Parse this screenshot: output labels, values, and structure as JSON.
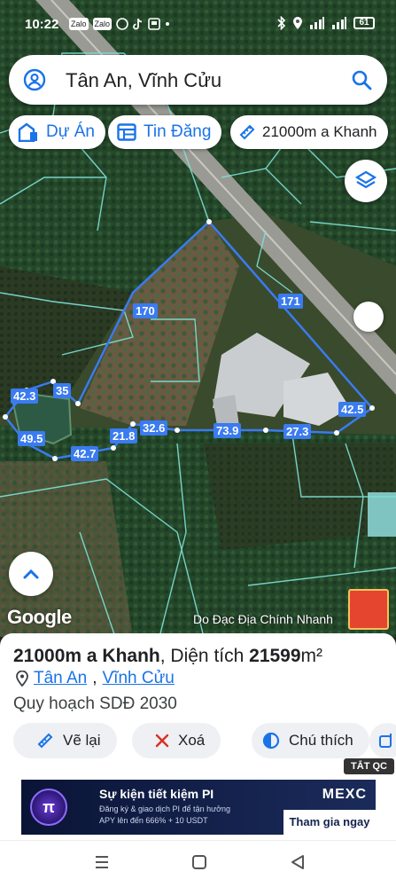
{
  "status_bar": {
    "time": "10:22",
    "app_badges": [
      "Zalo",
      "Zalo"
    ],
    "battery": "61"
  },
  "search": {
    "query": "Tân An, Vĩnh Cửu"
  },
  "chips": [
    {
      "label": "Dự Án",
      "icon": "building-icon"
    },
    {
      "label": "Tin Đăng",
      "icon": "listing-icon"
    },
    {
      "label": "21000m a Khanh",
      "icon": "ruler-icon"
    }
  ],
  "map": {
    "google_logo": "Google",
    "watermark": "Do Đạc Địa Chính Nhanh",
    "edge_lengths": [
      "170",
      "171",
      "35",
      "42.3",
      "49.5",
      "42.7",
      "21.8",
      "32.6",
      "73.9",
      "27.3",
      "42.5"
    ],
    "boundary_color": "#3a7bf0",
    "parcel_line_color": "#7fe3d8"
  },
  "place": {
    "name": "21000m a Khanh",
    "area_label": "Diện tích",
    "area_value": "21599",
    "area_unit": "m²",
    "ward": "Tân An",
    "district": "Vĩnh Cửu",
    "plan": "Quy hoạch SDĐ 2030"
  },
  "actions": [
    {
      "label": "Vẽ lại",
      "icon": "redraw-icon"
    },
    {
      "label": "Xoá",
      "icon": "close-icon"
    },
    {
      "label": "Chú thích",
      "icon": "legend-icon"
    }
  ],
  "ad": {
    "hide_label": "TẮT QC",
    "headline": "Sự kiện tiết kiệm PI",
    "line1": "Đăng ký & giao dịch PI để tận hưởng",
    "line2": "APY lên đến 666% + 10 USDT",
    "brand": "MEXC",
    "cta": "Tham gia ngay"
  }
}
